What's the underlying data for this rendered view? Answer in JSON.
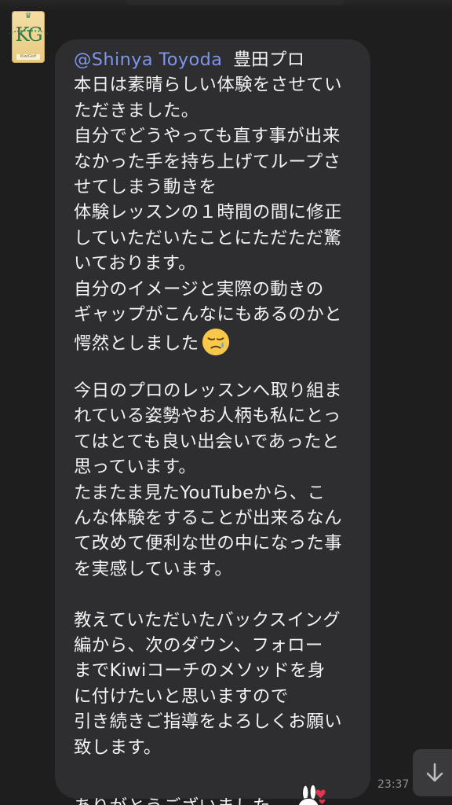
{
  "chat": {
    "sender_avatar": {
      "logo_text": "KG",
      "tag_text": "KiwiGolf"
    },
    "message": {
      "mention": "@Shinya Toyoda",
      "line_0_rest": "豊田プロ",
      "lines": [
        "本日は素晴らしい体験をさせてい",
        "ただきました。",
        "自分でどうやっても直す事が出来",
        "なかった手を持ち上げてループさ",
        "せてしまう動きを",
        "体験レッスンの１時間の間に修正",
        "していただいたことにただただ驚",
        "いております。",
        "自分のイメージと実際の動きの",
        "ギャップがこんなにもあるのかと",
        "愕然としました",
        "",
        "今日のプロのレッスンへ取り組ま",
        "れている姿勢やお人柄も私にとっ",
        "てはとても良い出会いであったと",
        "思っています。",
        "たまたま見たYouTubeから、こ",
        "んな体験をすることが出来るなん",
        "て改めて便利な世の中になった事",
        "を実感しています。",
        "",
        "教えていただいたバックスイング",
        "編から、次のダウン、フォロー",
        "までKiwiコーチのメソッドを身",
        "に付けたいと思いますので",
        "引き続きご指導をよろしくお願い",
        "致します。",
        "",
        "ありがとうございました。"
      ],
      "sad_emoji": "sad-face-emoji",
      "sticker": "bunny-sticker-with-hearts",
      "time": "23:37"
    },
    "scroll_down_icon": "arrow-down-icon"
  }
}
